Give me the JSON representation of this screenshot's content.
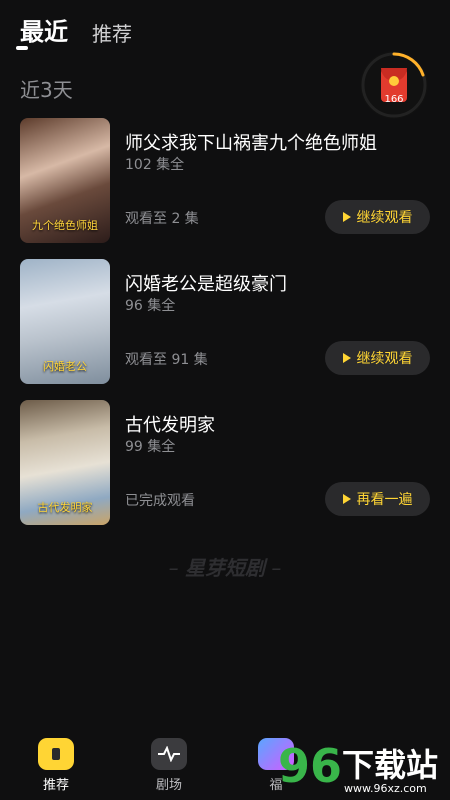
{
  "header": {
    "tabs": [
      {
        "label": "最近",
        "active": true
      },
      {
        "label": "推荐",
        "active": false
      }
    ]
  },
  "section": {
    "title": "近3天"
  },
  "reward": {
    "count": "166"
  },
  "items": [
    {
      "title": "师父求我下山祸害九个绝色师姐",
      "episodes": "102 集全",
      "progress": "观看至 2 集",
      "action": "继续观看",
      "poster_text": "九个绝色师姐"
    },
    {
      "title": "闪婚老公是超级豪门",
      "episodes": "96 集全",
      "progress": "观看至 91 集",
      "action": "继续观看",
      "poster_text": "闪婚老公"
    },
    {
      "title": "古代发明家",
      "episodes": "99 集全",
      "progress": "已完成观看",
      "action": "再看一遍",
      "poster_text": "古代发明家"
    }
  ],
  "brand": {
    "text": "星芽短剧"
  },
  "bottom_nav": [
    {
      "label": "推荐",
      "icon": "home-icon",
      "active": true
    },
    {
      "label": "剧场",
      "icon": "theater-icon",
      "active": false
    },
    {
      "label": "福",
      "icon": "welfare-icon",
      "active": false
    }
  ],
  "watermark": {
    "number": "96",
    "text": "下载站",
    "url": "www.96xz.com"
  },
  "colors": {
    "accent": "#ffd534",
    "background": "#0f0f10",
    "muted": "#8e8f93",
    "reward_red": "#e23b2e"
  }
}
